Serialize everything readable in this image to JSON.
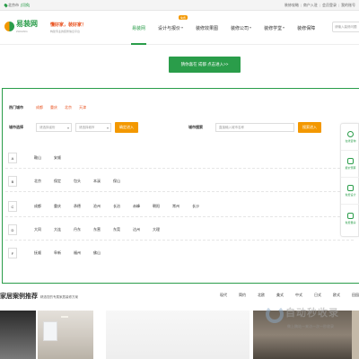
{
  "topbar": {
    "location": "北京市",
    "switch_city": "[切换]",
    "links": [
      "装修攻略",
      "商户入驻",
      "会员登录",
      "我的账号"
    ]
  },
  "header": {
    "logo_name": "易装网",
    "logo_sub": "ZHUANG",
    "slogan_main": "懂好家，装好家！",
    "slogan_sub": "构建专业的装修信息平台",
    "nav": [
      {
        "label": "易装网",
        "active": true
      },
      {
        "label": "设计与报价",
        "badge": "免费",
        "caret": true
      },
      {
        "label": "装修效果图"
      },
      {
        "label": "装修公司",
        "caret": true
      },
      {
        "label": "装修学堂",
        "caret": true
      },
      {
        "label": "装修保障"
      }
    ],
    "search_placeholder": "请输入装修问题"
  },
  "cta": {
    "label": "猜你喜在 成都  点击进入>>"
  },
  "hot_cities": {
    "label": "热门城市",
    "cities": [
      "成都",
      "重庆",
      "北京",
      "天津"
    ]
  },
  "city_select": {
    "label": "城市选择",
    "province_placeholder": "请选择省份",
    "city_placeholder": "请选择城市",
    "enter_button": "确定进入"
  },
  "city_search": {
    "label": "城市搜索",
    "placeholder": "直接输入城市名称",
    "button": "搜索进入"
  },
  "alphabet": [
    {
      "letter": "A",
      "cities": [
        "鞍山",
        "安顺"
      ]
    },
    {
      "letter": "B",
      "cities": [
        "北京",
        "保定",
        "包头",
        "本溪",
        "保山"
      ]
    },
    {
      "letter": "C",
      "cities": [
        "成都",
        "重庆",
        "承德",
        "沧州",
        "长治",
        "赤峰",
        "朝阳",
        "常州",
        "长沙"
      ]
    },
    {
      "letter": "D",
      "cities": [
        "大同",
        "大连",
        "丹东",
        "东营",
        "东莞",
        "达州",
        "大理"
      ]
    },
    {
      "letter": "F",
      "cities": [
        "抚顺",
        "阜新",
        "福州",
        "佛山"
      ]
    }
  ],
  "side_tools": [
    {
      "label": "在线咨询",
      "icon": "chat-icon"
    },
    {
      "label": "报价预算",
      "icon": "calculator-icon"
    },
    {
      "label": "免费设计",
      "icon": "design-icon"
    },
    {
      "label": "免费量房",
      "icon": "measure-icon"
    }
  ],
  "cases": {
    "title": "家居案例推荐",
    "desc": "精选您的专属家居装修方案",
    "tabs": [
      "现代",
      "简约",
      "北欧",
      "美式",
      "中式",
      "日式",
      "欧式",
      "田园"
    ]
  },
  "watermark": {
    "main": "自动秒收录",
    "sub": "做上稿站一来访一次一秒收录"
  },
  "colors": {
    "brand": "#2a9d4a",
    "accent": "#f39800",
    "hot": "#e8501c"
  }
}
